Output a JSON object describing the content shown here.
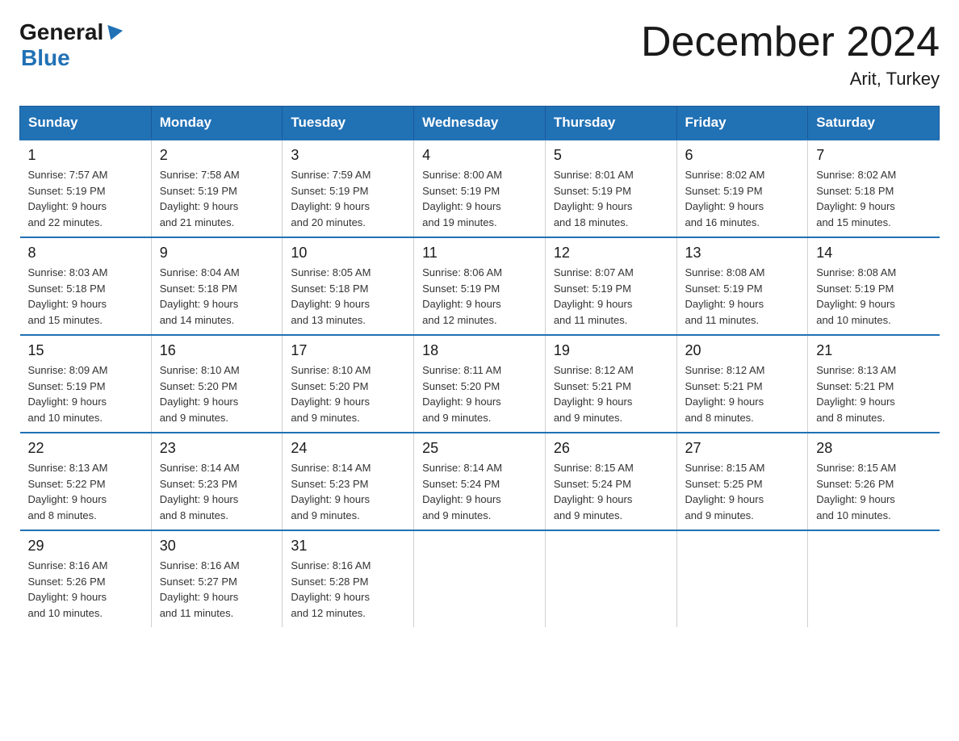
{
  "logo": {
    "general": "General",
    "blue": "Blue"
  },
  "title": {
    "month": "December 2024",
    "location": "Arit, Turkey"
  },
  "header_days": [
    "Sunday",
    "Monday",
    "Tuesday",
    "Wednesday",
    "Thursday",
    "Friday",
    "Saturday"
  ],
  "weeks": [
    [
      {
        "day": "1",
        "sunrise": "7:57 AM",
        "sunset": "5:19 PM",
        "daylight": "9 hours and 22 minutes."
      },
      {
        "day": "2",
        "sunrise": "7:58 AM",
        "sunset": "5:19 PM",
        "daylight": "9 hours and 21 minutes."
      },
      {
        "day": "3",
        "sunrise": "7:59 AM",
        "sunset": "5:19 PM",
        "daylight": "9 hours and 20 minutes."
      },
      {
        "day": "4",
        "sunrise": "8:00 AM",
        "sunset": "5:19 PM",
        "daylight": "9 hours and 19 minutes."
      },
      {
        "day": "5",
        "sunrise": "8:01 AM",
        "sunset": "5:19 PM",
        "daylight": "9 hours and 18 minutes."
      },
      {
        "day": "6",
        "sunrise": "8:02 AM",
        "sunset": "5:19 PM",
        "daylight": "9 hours and 16 minutes."
      },
      {
        "day": "7",
        "sunrise": "8:02 AM",
        "sunset": "5:18 PM",
        "daylight": "9 hours and 15 minutes."
      }
    ],
    [
      {
        "day": "8",
        "sunrise": "8:03 AM",
        "sunset": "5:18 PM",
        "daylight": "9 hours and 15 minutes."
      },
      {
        "day": "9",
        "sunrise": "8:04 AM",
        "sunset": "5:18 PM",
        "daylight": "9 hours and 14 minutes."
      },
      {
        "day": "10",
        "sunrise": "8:05 AM",
        "sunset": "5:18 PM",
        "daylight": "9 hours and 13 minutes."
      },
      {
        "day": "11",
        "sunrise": "8:06 AM",
        "sunset": "5:19 PM",
        "daylight": "9 hours and 12 minutes."
      },
      {
        "day": "12",
        "sunrise": "8:07 AM",
        "sunset": "5:19 PM",
        "daylight": "9 hours and 11 minutes."
      },
      {
        "day": "13",
        "sunrise": "8:08 AM",
        "sunset": "5:19 PM",
        "daylight": "9 hours and 11 minutes."
      },
      {
        "day": "14",
        "sunrise": "8:08 AM",
        "sunset": "5:19 PM",
        "daylight": "9 hours and 10 minutes."
      }
    ],
    [
      {
        "day": "15",
        "sunrise": "8:09 AM",
        "sunset": "5:19 PM",
        "daylight": "9 hours and 10 minutes."
      },
      {
        "day": "16",
        "sunrise": "8:10 AM",
        "sunset": "5:20 PM",
        "daylight": "9 hours and 9 minutes."
      },
      {
        "day": "17",
        "sunrise": "8:10 AM",
        "sunset": "5:20 PM",
        "daylight": "9 hours and 9 minutes."
      },
      {
        "day": "18",
        "sunrise": "8:11 AM",
        "sunset": "5:20 PM",
        "daylight": "9 hours and 9 minutes."
      },
      {
        "day": "19",
        "sunrise": "8:12 AM",
        "sunset": "5:21 PM",
        "daylight": "9 hours and 9 minutes."
      },
      {
        "day": "20",
        "sunrise": "8:12 AM",
        "sunset": "5:21 PM",
        "daylight": "9 hours and 8 minutes."
      },
      {
        "day": "21",
        "sunrise": "8:13 AM",
        "sunset": "5:21 PM",
        "daylight": "9 hours and 8 minutes."
      }
    ],
    [
      {
        "day": "22",
        "sunrise": "8:13 AM",
        "sunset": "5:22 PM",
        "daylight": "9 hours and 8 minutes."
      },
      {
        "day": "23",
        "sunrise": "8:14 AM",
        "sunset": "5:23 PM",
        "daylight": "9 hours and 8 minutes."
      },
      {
        "day": "24",
        "sunrise": "8:14 AM",
        "sunset": "5:23 PM",
        "daylight": "9 hours and 9 minutes."
      },
      {
        "day": "25",
        "sunrise": "8:14 AM",
        "sunset": "5:24 PM",
        "daylight": "9 hours and 9 minutes."
      },
      {
        "day": "26",
        "sunrise": "8:15 AM",
        "sunset": "5:24 PM",
        "daylight": "9 hours and 9 minutes."
      },
      {
        "day": "27",
        "sunrise": "8:15 AM",
        "sunset": "5:25 PM",
        "daylight": "9 hours and 9 minutes."
      },
      {
        "day": "28",
        "sunrise": "8:15 AM",
        "sunset": "5:26 PM",
        "daylight": "9 hours and 10 minutes."
      }
    ],
    [
      {
        "day": "29",
        "sunrise": "8:16 AM",
        "sunset": "5:26 PM",
        "daylight": "9 hours and 10 minutes."
      },
      {
        "day": "30",
        "sunrise": "8:16 AM",
        "sunset": "5:27 PM",
        "daylight": "9 hours and 11 minutes."
      },
      {
        "day": "31",
        "sunrise": "8:16 AM",
        "sunset": "5:28 PM",
        "daylight": "9 hours and 12 minutes."
      },
      null,
      null,
      null,
      null
    ]
  ],
  "labels": {
    "sunrise": "Sunrise:",
    "sunset": "Sunset:",
    "daylight": "Daylight:"
  }
}
